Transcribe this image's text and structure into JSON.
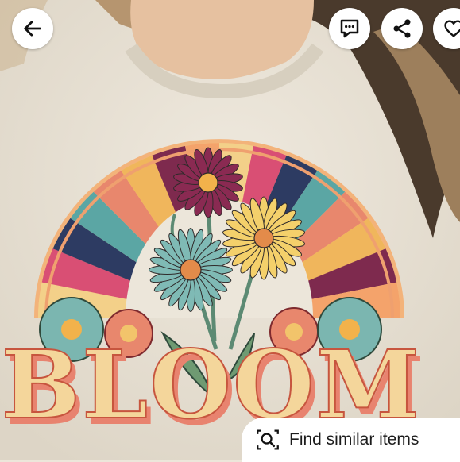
{
  "image": {
    "subject": "t-shirt-graphic",
    "graphic_text": "BLOOM",
    "colors": {
      "shirt": "#ece6da",
      "hair": "#a88762",
      "skin": "#e3bd9c",
      "text_fill": "#f4d69b",
      "text_shadow": "#e8836f",
      "rays": [
        "#f3d089",
        "#d94f74",
        "#2d3b62",
        "#5ba6a4",
        "#e8876d",
        "#f0b65c",
        "#7e2a4e",
        "#f4a36b"
      ]
    }
  },
  "toolbar": {
    "back_icon": "arrow-left-icon",
    "message_icon": "message-dots-icon",
    "share_icon": "share-icon",
    "favorite_icon": "heart-icon"
  },
  "find_similar": {
    "label": "Find similar items",
    "icon": "visual-search-icon"
  }
}
